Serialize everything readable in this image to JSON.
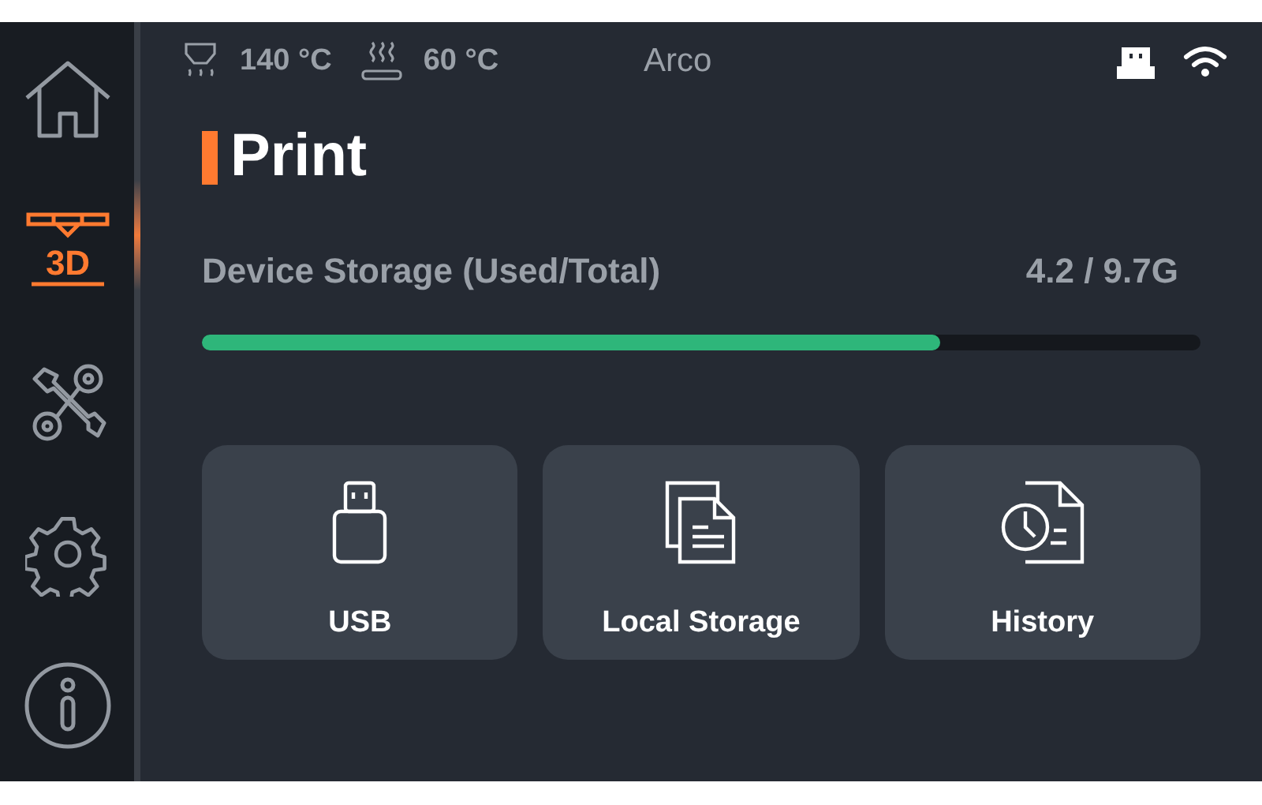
{
  "sidebar": {
    "items": [
      {
        "kind": "home",
        "selected": false
      },
      {
        "kind": "print3d",
        "selected": true,
        "label": "3D"
      },
      {
        "kind": "tools",
        "selected": false
      },
      {
        "kind": "settings",
        "selected": false
      },
      {
        "kind": "info",
        "selected": false
      }
    ]
  },
  "status_bar": {
    "nozzle_temp": "140 °C",
    "bed_temp": "60 °C",
    "device_name": "Arco"
  },
  "title": "Print",
  "storage": {
    "label": "Device Storage (Used/Total)",
    "reading": "4.2 / 9.7G",
    "level": 0.74
  },
  "sources": [
    {
      "kind": "usb",
      "label": "USB"
    },
    {
      "kind": "local",
      "label": "Local Storage"
    },
    {
      "kind": "history",
      "label": "History"
    }
  ]
}
